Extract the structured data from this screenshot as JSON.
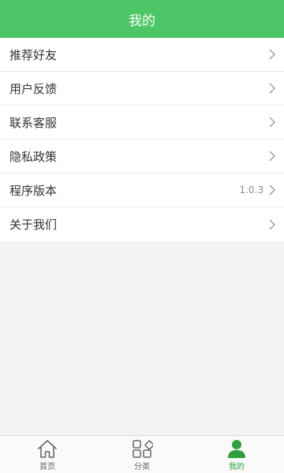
{
  "header": {
    "title": "我的"
  },
  "menu": {
    "items": [
      {
        "label": "推荐好友",
        "value": ""
      },
      {
        "label": "用户反馈",
        "value": ""
      },
      {
        "label": "联系客服",
        "value": ""
      },
      {
        "label": "隐私政策",
        "value": ""
      },
      {
        "label": "程序版本",
        "value": "1.0.3"
      },
      {
        "label": "关于我们",
        "value": ""
      }
    ],
    "chevron_icon": "chevron-right-icon"
  },
  "tabbar": {
    "tabs": [
      {
        "label": "首页",
        "icon": "home-icon",
        "active": false
      },
      {
        "label": "分类",
        "icon": "category-grid-icon",
        "active": false
      },
      {
        "label": "我的",
        "icon": "user-icon",
        "active": true
      }
    ],
    "active_color": "#2e9f3e",
    "inactive_color": "#666666"
  },
  "colors": {
    "header_bg": "#4dc667",
    "page_bg": "#f3f3f3"
  }
}
